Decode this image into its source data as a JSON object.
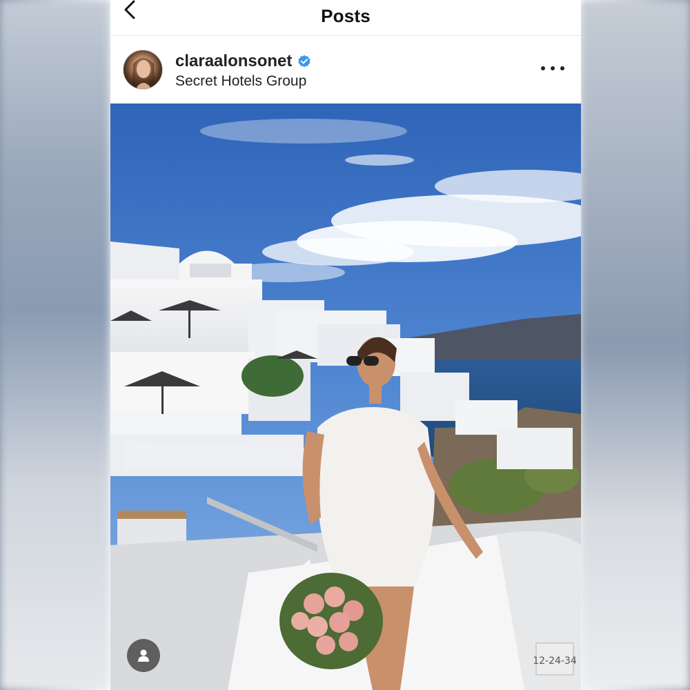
{
  "nav": {
    "title": "Posts",
    "back_icon": "chevron-left-icon"
  },
  "post": {
    "username": "claraalonsonet",
    "verified_icon": "verified-badge-icon",
    "location": "Secret Hotels Group",
    "more_icon": "more-horizontal-icon",
    "tag_icon": "user-tag-icon",
    "photo_sign_text": "12-24-34"
  },
  "colors": {
    "verified": "#3897f0",
    "text": "#222222"
  }
}
